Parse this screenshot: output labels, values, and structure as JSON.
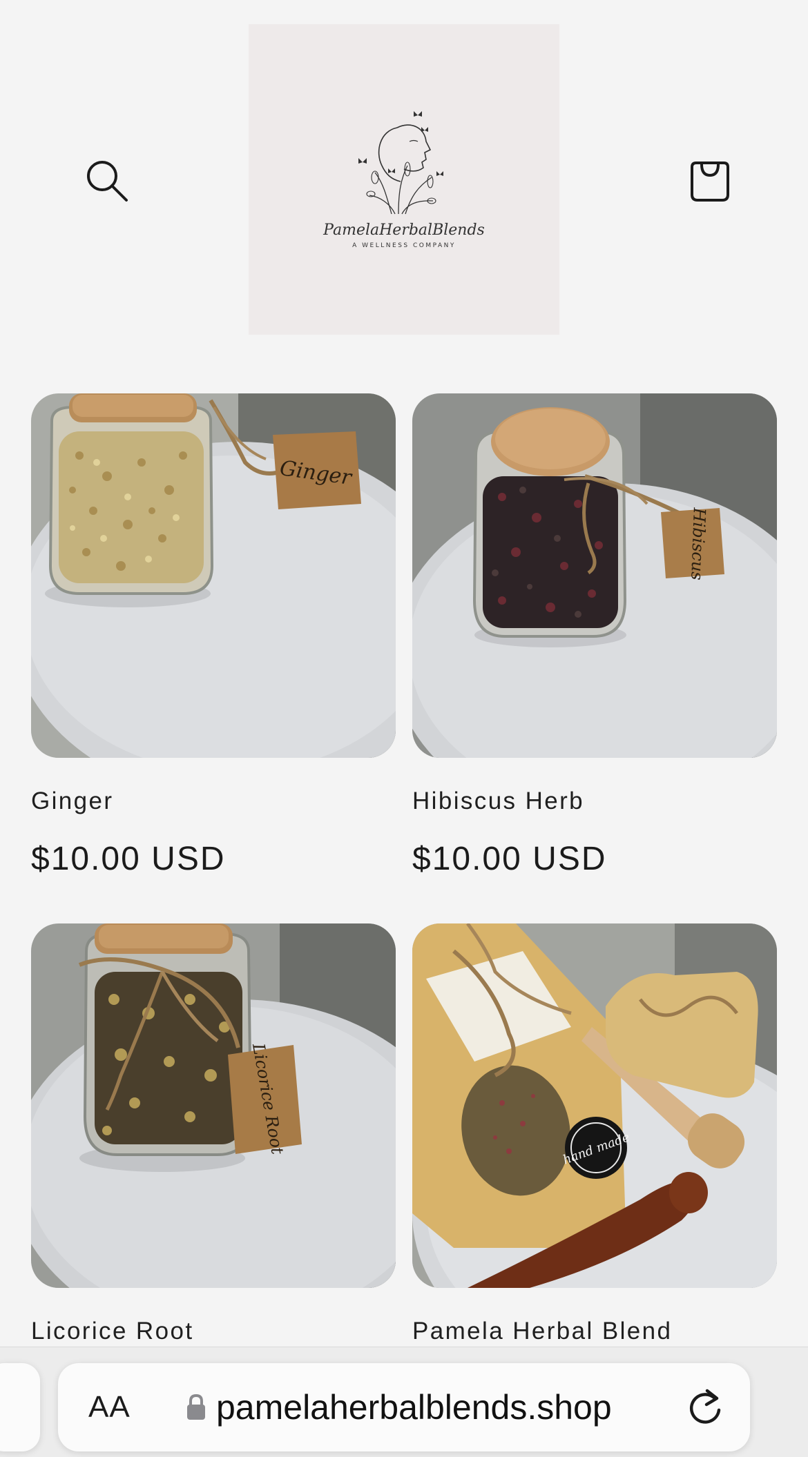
{
  "header": {
    "logo": {
      "brand": "PamelaHerbalBlends",
      "tagline": "A WELLNESS COMPANY"
    }
  },
  "products": [
    {
      "name": "Ginger",
      "price": "$10.00 USD",
      "tag": "Ginger"
    },
    {
      "name": "Hibiscus Herb",
      "price": "$10.00 USD",
      "tag": "Hibiscus"
    },
    {
      "name": "Licorice Root",
      "price": "",
      "tag": "Licorice Root"
    },
    {
      "name": "Pamela Herbal Blend",
      "price": "",
      "tag": "hand made"
    }
  ],
  "browser": {
    "text_size_label": "AA",
    "url": "pamelaherbalblends.shop"
  },
  "colors": {
    "page_background": "#f4f4f4",
    "logo_background": "#eeeaea",
    "text": "#1b1b1b"
  }
}
